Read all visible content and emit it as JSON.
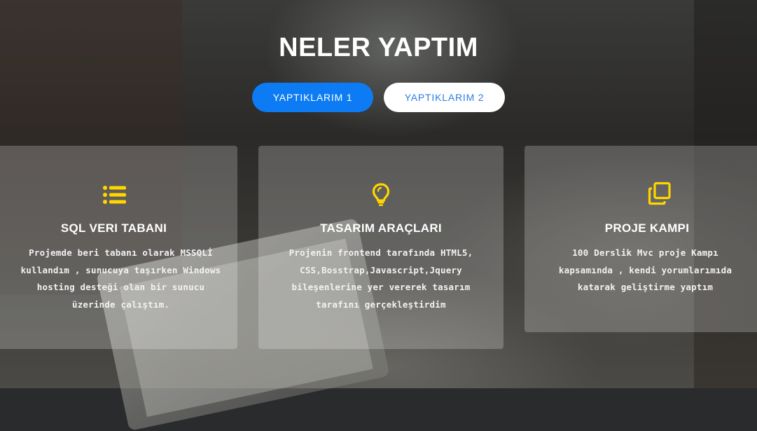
{
  "section": {
    "title": "NELER YAPTIM"
  },
  "tabs": [
    {
      "label": "YAPTIKLARIM 1",
      "active": true
    },
    {
      "label": "YAPTIKLARIM 2",
      "active": false
    }
  ],
  "cards": [
    {
      "icon": "list-icon",
      "title": "SQL VERI TABANI",
      "text": "Projemde beri tabanı olarak MSSQLİ kullandım , sunucuya taşırken Windows hosting desteği olan bir sunucu üzerinde çalıştım."
    },
    {
      "icon": "lightbulb-icon",
      "title": "TASARIM ARAÇLARI",
      "text": "Projenin frontend tarafında HTML5, CSS,Bosstrap,Javascript,Jquery bileşenlerine yer vererek tasarım tarafını gerçekleştirdim"
    },
    {
      "icon": "copy-icon",
      "title": "PROJE KAMPI",
      "text": "100 Derslik Mvc proje Kampı kapsamında , kendi yorumlarımıda katarak geliştirme yaptım"
    }
  ],
  "colors": {
    "accent": "#0d7cf4",
    "icon": "#ffd600",
    "tab_inactive_text": "#2b7de6"
  }
}
